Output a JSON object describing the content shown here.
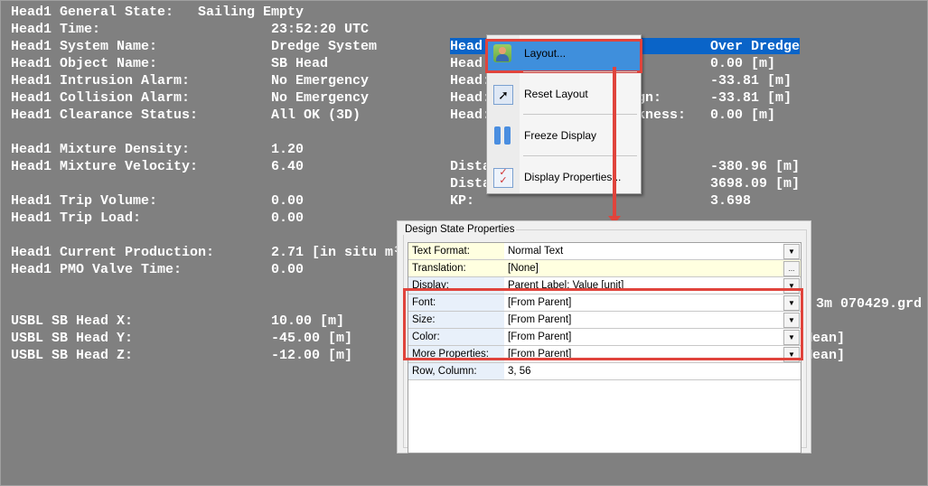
{
  "left_rows": [
    {
      "label": "Head1 General State:",
      "value": "Sailing Empty"
    },
    {
      "label": "Head1 Time:",
      "value": "23:52:20 UTC"
    },
    {
      "label": "Head1 System Name:",
      "value": "Dredge System"
    },
    {
      "label": "Head1 Object Name:",
      "value": "SB Head"
    },
    {
      "label": "Head1 Intrusion Alarm:",
      "value": "No Emergency"
    },
    {
      "label": "Head1 Collision Alarm:",
      "value": "No Emergency"
    },
    {
      "label": "Head1 Clearance Status:",
      "value": "All OK (3D)"
    },
    {
      "label": "Head1 Mixture Density:",
      "value": "1.20"
    },
    {
      "label": "Head1 Mixture Velocity:",
      "value": "6.40"
    },
    {
      "label": "Head1 Trip Volume:",
      "value": "0.00"
    },
    {
      "label": "Head1 Trip Load:",
      "value": "0.00"
    },
    {
      "label": "Head1 Current Production:",
      "value": "2.71 [in situ m³"
    },
    {
      "label": "Head1 PMO Valve Time:",
      "value": "0.00"
    },
    {
      "label": "USBL SB Head X:",
      "value": "10.00 [m]"
    },
    {
      "label": "USBL SB Head Y:",
      "value": "-45.00 [m]"
    },
    {
      "label": "USBL SB Head Z:",
      "value": "-12.00 [m]"
    }
  ],
  "right_rows": [
    {
      "label": "Head",
      "mid": "",
      "value": "Over Dredge"
    },
    {
      "label": "Head",
      "mid": "",
      "value": "0.00 [m]"
    },
    {
      "label": "Head:",
      "mid": "",
      "value": "-33.81 [m]"
    },
    {
      "label": "Head:",
      "mid": "gn:",
      "value": "-33.81 [m]"
    },
    {
      "label": "Head:",
      "mid": "ckness:",
      "value": "0.00 [m]"
    },
    {
      "label": "Dista",
      "mid": "",
      "value": "-380.96 [m]"
    },
    {
      "label": "Dista",
      "mid": "",
      "value": "3698.09 [m]"
    },
    {
      "label": "KP:",
      "mid": "",
      "value": "3.698"
    }
  ],
  "far_right": {
    "grid_file": "3m 070429.grd",
    "mean1": "Mean]",
    "mean2": "Mean]"
  },
  "context_menu": {
    "items": [
      "Layout...",
      "Reset Layout",
      "Freeze Display",
      "Display Properties..."
    ]
  },
  "dialog": {
    "title": "Design State Properties",
    "rows": [
      {
        "label": "Text Format:",
        "value": "Normal Text",
        "control": "▼"
      },
      {
        "label": "Translation:",
        "value": "[None]",
        "control": "..."
      },
      {
        "label": "Display:",
        "value": "Parent Label: Value [unit]",
        "control": "▼"
      },
      {
        "label": "Font:",
        "value": "[From Parent]",
        "control": "▼"
      },
      {
        "label": "Size:",
        "value": "[From Parent]",
        "control": "▼"
      },
      {
        "label": "Color:",
        "value": "[From Parent]",
        "control": "▼"
      },
      {
        "label": "More Properties:",
        "value": "[From Parent]",
        "control": "▼"
      },
      {
        "label": "Row, Column:",
        "value": "3, 56",
        "control": ""
      }
    ]
  },
  "colors": {
    "highlight": "#0a64c8",
    "annotation": "#e0443c",
    "background": "#808080"
  }
}
